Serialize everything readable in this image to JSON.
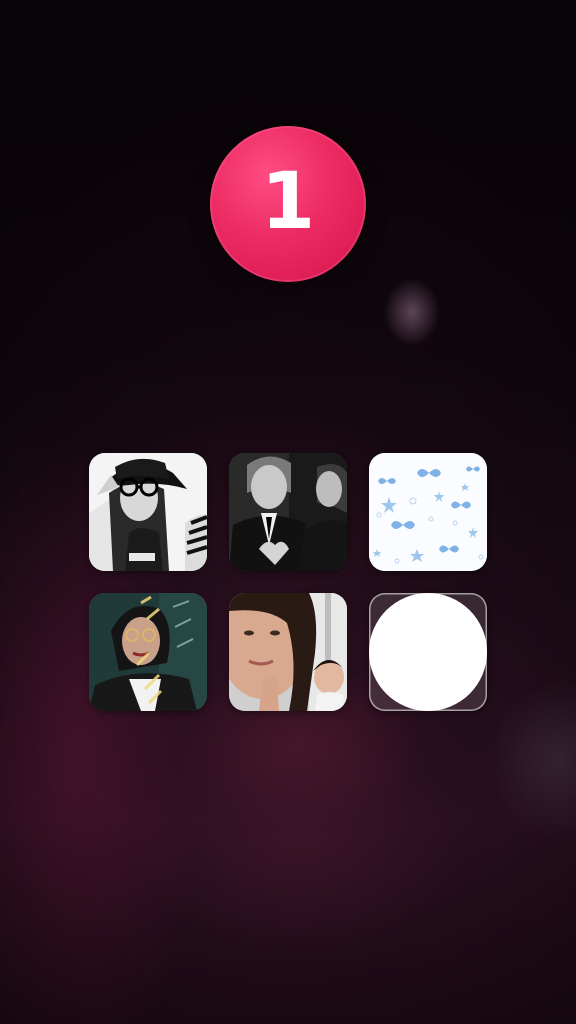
{
  "counter": {
    "value": "1",
    "color": "#ec2a63"
  },
  "grid": {
    "tiles": [
      {
        "icon": "photo-hat-glasses"
      },
      {
        "icon": "photo-suit-heart-hands"
      },
      {
        "icon": "photo-butterfly-pattern"
      },
      {
        "icon": "photo-glasses-portrait"
      },
      {
        "icon": "photo-selfie"
      },
      {
        "icon": "white-dot",
        "state": "entered"
      }
    ]
  }
}
